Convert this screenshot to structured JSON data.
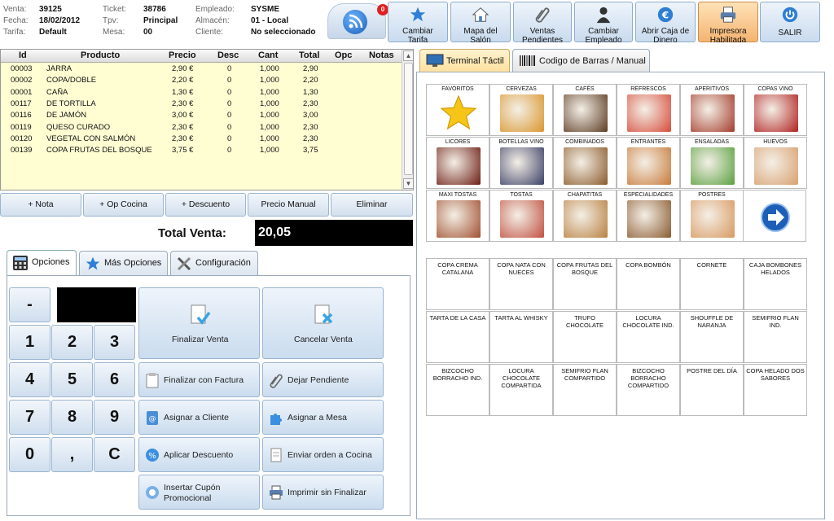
{
  "header": {
    "venta_label": "Venta:",
    "venta": "39125",
    "ticket_label": "Ticket:",
    "ticket": "38786",
    "empleado_label": "Empleado:",
    "empleado": "SYSME",
    "fecha_label": "Fecha:",
    "fecha": "18/02/2012",
    "tpv_label": "Tpv:",
    "tpv": "Principal",
    "almacen_label": "Almacén:",
    "almacen": "01 - Local",
    "tarifa_label": "Tarifa:",
    "tarifa": "Default",
    "mesa_label": "Mesa:",
    "mesa": "00",
    "cliente_label": "Cliente:",
    "cliente": "No seleccionado",
    "rss_badge": "0"
  },
  "toolbar": [
    {
      "l1": "Cambiar",
      "l2": "Tarifa",
      "icon": "star-icon"
    },
    {
      "l1": "Mapa del",
      "l2": "Salón",
      "icon": "house-icon"
    },
    {
      "l1": "Ventas",
      "l2": "Pendientes",
      "icon": "clip-icon"
    },
    {
      "l1": "Cambiar",
      "l2": "Empleado",
      "icon": "person-icon"
    },
    {
      "l1": "Abrir Caja de",
      "l2": "Dinero",
      "icon": "euro-icon"
    },
    {
      "l1": "Impresora",
      "l2": "Habilitada",
      "icon": "printer-icon"
    },
    {
      "l1": "SALIR",
      "l2": "",
      "icon": "power-icon"
    }
  ],
  "grid": {
    "columns": [
      "Id",
      "Producto",
      "Precio",
      "Desc",
      "Cant",
      "Total",
      "Opc",
      "Notas"
    ],
    "rows": [
      [
        "00003",
        "JARRA",
        "2,90 €",
        "0",
        "1,000",
        "2,90"
      ],
      [
        "00002",
        "COPA/DOBLE",
        "2,20 €",
        "0",
        "1,000",
        "2,20"
      ],
      [
        "00001",
        "CAÑA",
        "1,30 €",
        "0",
        "1,000",
        "1,30"
      ],
      [
        "00117",
        "DE TORTILLA",
        "2,30 €",
        "0",
        "1,000",
        "2,30"
      ],
      [
        "00116",
        "DE JAMÓN",
        "3,00 €",
        "0",
        "1,000",
        "3,00"
      ],
      [
        "00119",
        "QUESO CURADO",
        "2,30 €",
        "0",
        "1,000",
        "2,30"
      ],
      [
        "00120",
        "VEGETAL CON SALMÓN",
        "2,30 €",
        "0",
        "1,000",
        "2,30"
      ],
      [
        "00139",
        "COPA FRUTAS DEL BOSQUE",
        "3,75 €",
        "0",
        "1,000",
        "3,75"
      ]
    ]
  },
  "actions": [
    "+ Nota",
    "+ Op Cocina",
    "+ Descuento",
    "Precio Manual",
    "Eliminar"
  ],
  "total": {
    "label": "Total Venta:",
    "value": "20,05"
  },
  "tabs": [
    "Opciones",
    "Más Opciones",
    "Configuración"
  ],
  "keypad": [
    "-",
    "1",
    "2",
    "3",
    "4",
    "5",
    "6",
    "7",
    "8",
    "9",
    "0",
    ",",
    "C"
  ],
  "functions": [
    "Finalizar Venta",
    "Cancelar Venta",
    "Finalizar con Factura",
    "Dejar Pendiente",
    "Asignar a Cliente",
    "Asignar a Mesa",
    "Aplicar Descuento",
    "Enviar orden a Cocina",
    "Insertar Cupón",
    "Promocional",
    "Imprimir sin Finalizar"
  ],
  "right_tabs": [
    "Terminal Táctil",
    "Codigo de Barras / Manual"
  ],
  "categories": [
    "FAVORITOS",
    "CERVEZAS",
    "CAFÉS",
    "REFRESCOS",
    "APERITIVOS",
    "COPAS VINO",
    "LICORES",
    "BOTELLAS VINO",
    "COMBINADOS",
    "ENTRANTES",
    "ENSALADAS",
    "HUEVOS",
    "MAXI TOSTAS",
    "TOSTAS",
    "CHAPATITAS",
    "ESPECIALIDADES",
    "POSTRES"
  ],
  "products": [
    [
      "COPA CREMA",
      "CATALANA"
    ],
    [
      "COPA NATA CON",
      "NUECES"
    ],
    [
      "COPA FRUTAS DEL",
      "BOSQUE"
    ],
    [
      "COPA BOMBÓN",
      ""
    ],
    [
      "CORNETE",
      ""
    ],
    [
      "CAJA BOMBONES",
      "HELADOS"
    ],
    [
      "TARTA DE LA CASA",
      ""
    ],
    [
      "TARTA AL WHISKY",
      ""
    ],
    [
      "TRUFO CHOCOLATE",
      ""
    ],
    [
      "LOCURA",
      "CHOCOLATE IND."
    ],
    [
      "SHOUFFLE DE",
      "NARANJA"
    ],
    [
      "SEMIFRIO FLAN",
      "IND."
    ],
    [
      "BIZCOCHO",
      "BORRACHO IND."
    ],
    [
      "LOCURA",
      "CHOCOLATE",
      "COMPARTIDA"
    ],
    [
      "SEMIFRIO FLAN",
      "COMPARTIDO"
    ],
    [
      "BIZCOCHO",
      "BORRACHO",
      "COMPARTIDO"
    ],
    [
      "POSTRE DEL DÍA",
      ""
    ],
    [
      "COPA HELADO DOS",
      "SABORES"
    ]
  ]
}
